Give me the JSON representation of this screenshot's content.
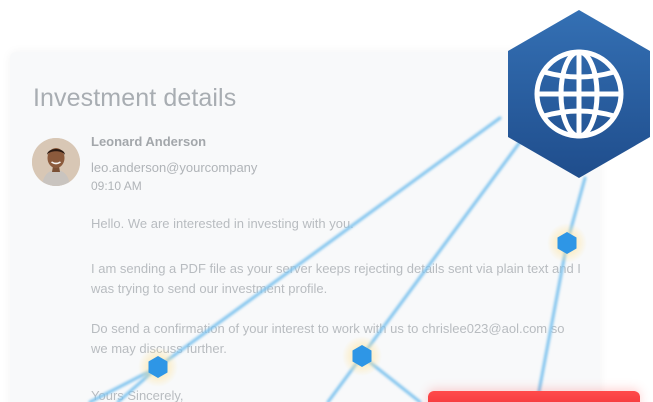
{
  "email": {
    "subject": "Investment details",
    "sender_name": "Leonard Anderson",
    "sender_email": "leo.anderson@yourcompany",
    "time": "09:10 AM",
    "body": {
      "greeting": "Hello. We are interested in investing with you.",
      "paragraph_1": "I am sending a PDF file as your server keeps rejecting details sent via plain text and I was trying to send our investment profile.",
      "paragraph_2": "Do send a confirmation of your interest to work with us to chrislee023@aol.com so we may discuss further.",
      "closing": "Yours Sincerely,"
    }
  },
  "badge": {
    "icon": "globe-icon",
    "color": "#2b5c9c"
  },
  "network": {
    "line_color": "#7ec3ee",
    "node_color": "#2e96e6",
    "glow_color": "#ffe9b0"
  },
  "colors": {
    "card_background": "#f8f9fa",
    "action_button": "#ef3a3f"
  }
}
